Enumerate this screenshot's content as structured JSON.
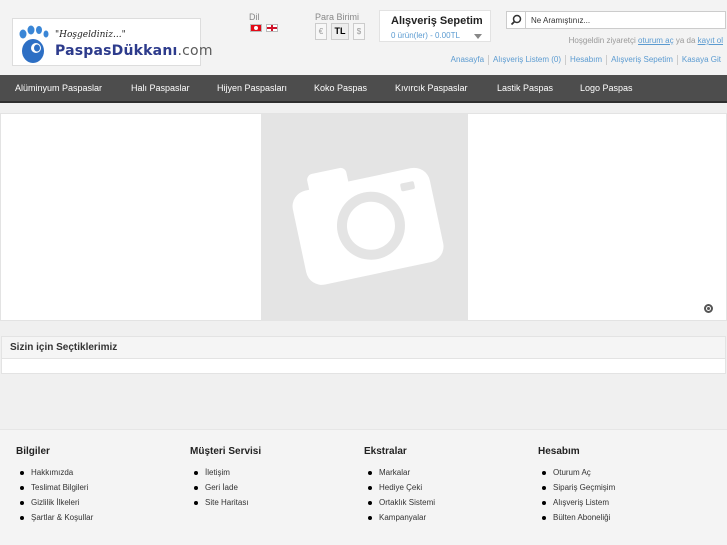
{
  "logo": {
    "welcome": "\"Hoşgeldiniz...\"",
    "name_brand": "Paspas",
    "name_rest": "Dükkanı",
    "name_tld": ".com"
  },
  "language": {
    "label": "Dil"
  },
  "currency": {
    "label": "Para Birimi",
    "options": [
      "€",
      "TL",
      "$"
    ],
    "selected": "TL"
  },
  "cart": {
    "title": "Alışveriş Sepetim",
    "summary": "0 ürün(ler) - 0.00TL"
  },
  "search": {
    "placeholder": "Ne Aramıştınız..."
  },
  "welcome": {
    "text": "Hoşgeldin ziyaretçi",
    "login": "oturum aç",
    "or": "ya da",
    "register": "kayıt ol"
  },
  "toplinks": [
    "Anasayfa",
    "Alışveriş Listem (0)",
    "Hesabım",
    "Alışveriş Sepetim",
    "Kasaya Git"
  ],
  "menu": [
    "Alüminyum Paspaslar",
    "Halı Paspaslar",
    "Hijyen Paspasları",
    "Koko Paspas",
    "Kıvırcık Paspaslar",
    "Lastik Paspas",
    "Logo Paspas"
  ],
  "picks": {
    "title": "Sizin için Seçtiklerimiz"
  },
  "footer": {
    "columns": [
      {
        "title": "Bilgiler",
        "items": [
          "Hakkımızda",
          "Teslimat Bilgileri",
          "Gizlilik İlkeleri",
          "Şartlar & Koşullar"
        ]
      },
      {
        "title": "Müşteri Servisi",
        "items": [
          "İletişim",
          "Geri İade",
          "Site Haritası"
        ]
      },
      {
        "title": "Ekstralar",
        "items": [
          "Markalar",
          "Hediye Çeki",
          "Ortaklık Sistemi",
          "Kampanyalar"
        ]
      },
      {
        "title": "Hesabım",
        "items": [
          "Oturum Aç",
          "Sipariş Geçmişim",
          "Alışveriş Listem",
          "Bülten Aboneliği"
        ]
      }
    ]
  },
  "colors": {
    "menu_bg": "#4d4d4d",
    "link": "#5b9bd1",
    "logo_blue": "#2d3b8c"
  }
}
